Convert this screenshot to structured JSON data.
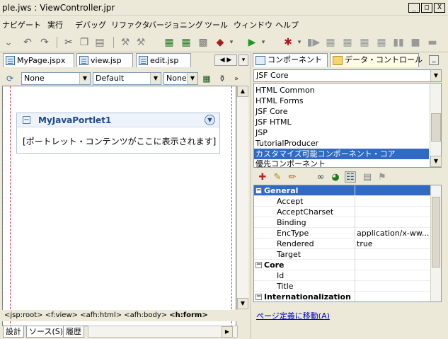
{
  "window": {
    "title": "ple.jws : ViewController.jpr",
    "min": "_",
    "max": "□",
    "close": "X"
  },
  "menu": [
    "ナビゲート",
    "実行",
    "デバッグ",
    "リファクタ",
    "バージョニング",
    "ツール",
    "ウィンドウ",
    "ヘルプ"
  ],
  "editor_tabs": [
    {
      "label": "MyPage.jspx"
    },
    {
      "label": "view.jsp"
    },
    {
      "label": "edit.jsp"
    }
  ],
  "editor_toolbar": {
    "style_select": "None",
    "font_select": "Default",
    "size_select": "None"
  },
  "portlet": {
    "title": "MyJavaPortlet1",
    "content": "[ポートレット・コンテンツがここに表示されます]"
  },
  "breadcrumb": {
    "path": "<jsp:root> <f:view> <afh:html> <afh:body> ",
    "current": "<h:form>"
  },
  "bottom_tabs": [
    "設計",
    "ソース(S)",
    "履歴"
  ],
  "palette_tabs": [
    "コンポーネント",
    "データ・コントロール"
  ],
  "palette_select": "JSF Core",
  "component_list": [
    "HTML Common",
    "HTML Forms",
    "JSF Core",
    "JSF HTML",
    "JSP",
    "TutorialProducer",
    "カスタマイズ可能コンポーネント・コア",
    "優先コンポーネント"
  ],
  "component_selected_index": 6,
  "properties": [
    {
      "type": "group",
      "name": "General",
      "expanded": true,
      "selected": true
    },
    {
      "type": "prop",
      "name": "Accept",
      "value": ""
    },
    {
      "type": "prop",
      "name": "AcceptCharset",
      "value": ""
    },
    {
      "type": "prop",
      "name": "Binding",
      "value": ""
    },
    {
      "type": "prop",
      "name": "EncType",
      "value": "application/x-ww..."
    },
    {
      "type": "prop",
      "name": "Rendered",
      "value": "true"
    },
    {
      "type": "prop",
      "name": "Target",
      "value": ""
    },
    {
      "type": "group",
      "name": "Core",
      "expanded": true,
      "selected": false
    },
    {
      "type": "prop",
      "name": "Id",
      "value": ""
    },
    {
      "type": "prop",
      "name": "Title",
      "value": ""
    },
    {
      "type": "group",
      "name": "Internationalization",
      "expanded": true,
      "selected": false
    }
  ],
  "page_link": "ページ定義に移動(A)"
}
